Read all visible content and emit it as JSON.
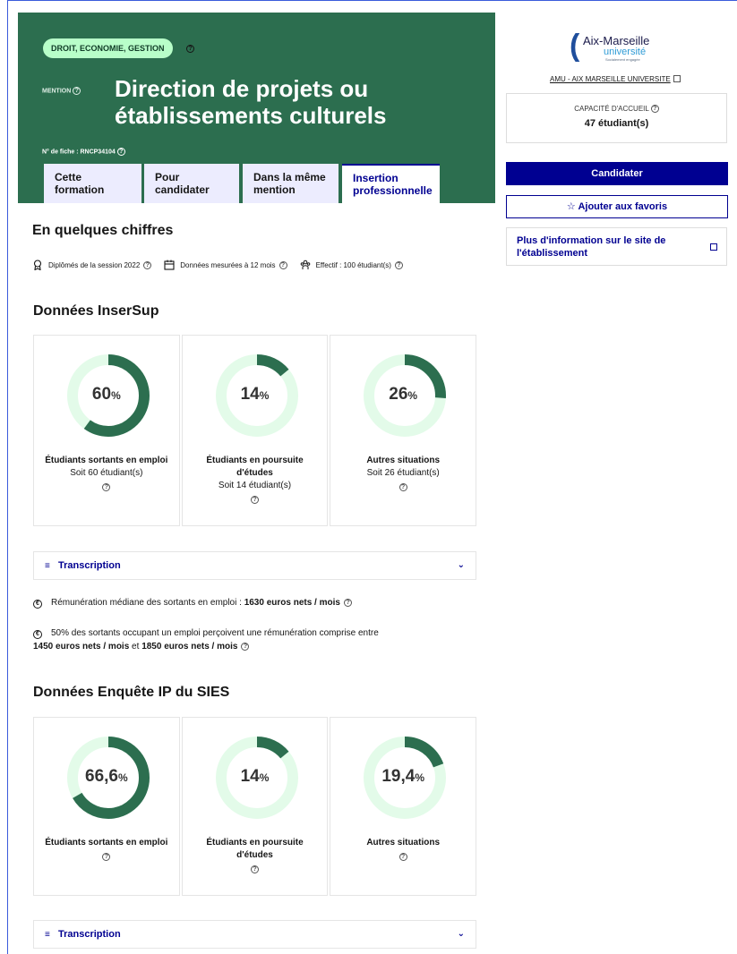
{
  "header": {
    "domain_pill": "DROIT, ECONOMIE, GESTION",
    "mention_label": "MENTION",
    "title": "Direction de projets ou établissements culturels",
    "fiche": "N° de fiche : RNCP34104",
    "tabs": [
      {
        "label": "Cette formation",
        "active": false
      },
      {
        "label": "Pour candidater",
        "active": false
      },
      {
        "label": "Dans la même mention",
        "active": false
      },
      {
        "label": "Insertion professionnelle",
        "active": true
      }
    ]
  },
  "sidebar": {
    "logo": {
      "main": "Aix-Marseille",
      "sub": "université",
      "tiny": "Socialement engagée"
    },
    "university_link": "AMU - AIX MARSEILLE UNIVERSITE",
    "capacity_label": "CAPACITÉ D'ACCUEIL",
    "capacity_value": "47 étudiant(s)",
    "apply_button": "Candidater",
    "favorite_button": "Ajouter aux favoris",
    "info_link": "Plus d'information sur le site de l'établissement"
  },
  "main": {
    "section1_title": "En quelques chiffres",
    "facts": [
      {
        "icon": "award-icon",
        "text": "Diplômés de la session 2022"
      },
      {
        "icon": "calendar-icon",
        "text": "Données mesurées à 12 mois"
      },
      {
        "icon": "group-icon",
        "text": "Effectif : 100 étudiant(s)"
      }
    ],
    "inserSup": {
      "title": "Données InserSup",
      "cards": [
        {
          "value": "60",
          "unit": "%",
          "percent": 60,
          "label": "Étudiants sortants en emploi",
          "sub": "Soit 60 étudiant(s)"
        },
        {
          "value": "14",
          "unit": "%",
          "percent": 14,
          "label": "Étudiants en poursuite d'études",
          "sub": "Soit 14 étudiant(s)"
        },
        {
          "value": "26",
          "unit": "%",
          "percent": 26,
          "label": "Autres situations",
          "sub": "Soit 26 étudiant(s)"
        }
      ],
      "transcription": "Transcription",
      "remuneration": {
        "line1_text": "Rémunération médiane des sortants en emploi : ",
        "line1_bold": "1630 euros nets / mois",
        "line2_text": "50% des sortants occupant un emploi perçoivent une rémunération comprise entre",
        "line2_bold1": "1450 euros nets / mois",
        "line2_mid": " et ",
        "line2_bold2": "1850 euros nets / mois"
      }
    },
    "sies": {
      "title": "Données Enquête IP du SIES",
      "cards": [
        {
          "value": "66,6",
          "unit": "%",
          "percent": 66.6,
          "label": "Étudiants sortants en emploi"
        },
        {
          "value": "14",
          "unit": "%",
          "percent": 14,
          "label": "Étudiants en poursuite d'études"
        },
        {
          "value": "19,4",
          "unit": "%",
          "percent": 19.4,
          "label": "Autres situations"
        }
      ],
      "transcription": "Transcription"
    }
  },
  "colors": {
    "hero": "#2c6e4f",
    "pill": "#b8fec9",
    "accent": "#000091",
    "ring_fill": "#2c6e4f",
    "ring_track": "#e3fbe9"
  }
}
